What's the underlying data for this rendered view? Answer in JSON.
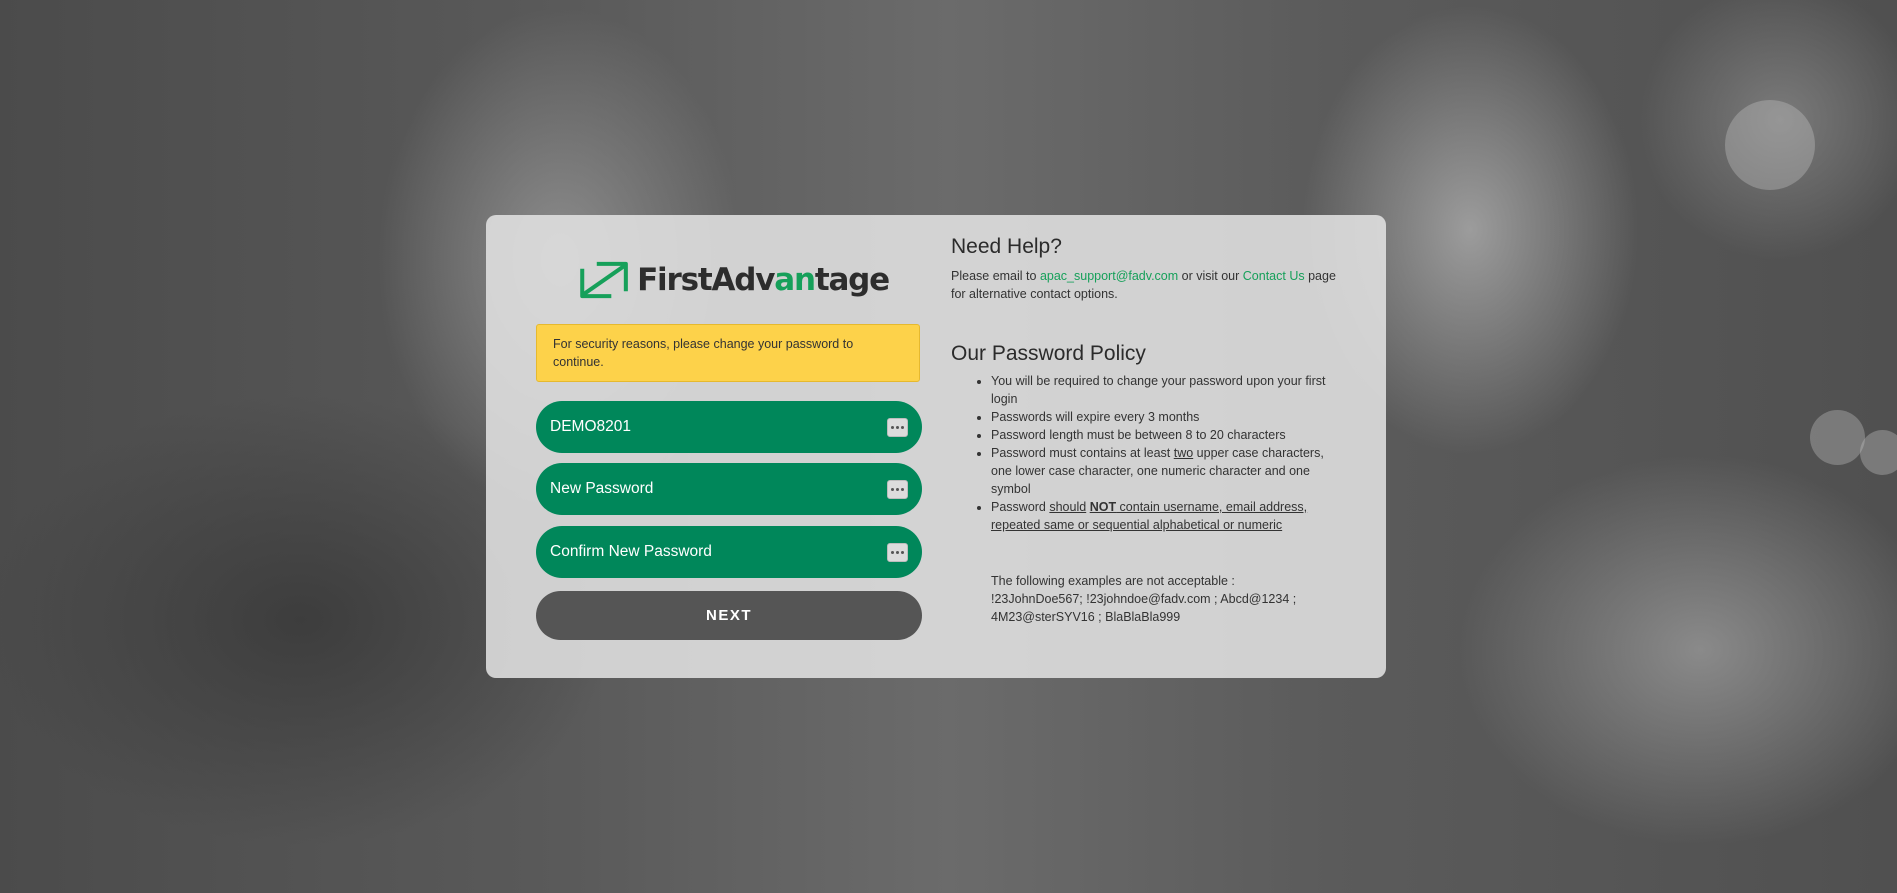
{
  "brand": {
    "logo_first": "First",
    "logo_adv": "Adv",
    "logo_an": "an",
    "logo_tage": "tage",
    "primary_color": "#00875a",
    "accent_color": "#16a05a"
  },
  "alert": {
    "text": "For security reasons, please change your password to continue."
  },
  "form": {
    "username_value": "DEMO8201",
    "new_password_placeholder": "New Password",
    "confirm_password_placeholder": "Confirm New Password",
    "field_icon": "ellipsis-icon",
    "next_label": "NEXT"
  },
  "help": {
    "title": "Need Help?",
    "text_prefix": "Please email to ",
    "email": "apac_support@fadv.com",
    "text_middle": " or visit our ",
    "contact_link": "Contact Us",
    "text_suffix": " page for alternative contact options."
  },
  "policy": {
    "title": "Our Password Policy",
    "item1": "You will be required to change your password upon your first login",
    "item2": "Passwords will expire every 3 months",
    "item3": "Password length must be between 8 to 20 characters",
    "item4_prefix": "Password must contains at least ",
    "item4_emph": "two",
    "item4_suffix": " upper case characters, one lower case character, one numeric character and one symbol",
    "item5_prefix": "Password ",
    "item5_should": "should",
    "item5_not": "NOT",
    "item5_rest": " contain username, email address, repeated same or sequential alphabetical or numeric",
    "examples_intro": "The following examples are not acceptable :",
    "examples_list": "!23JohnDoe567; !23johndoe@fadv.com ; Abcd@1234 ; 4M23@sterSYV16 ; BlaBlaBla999"
  }
}
